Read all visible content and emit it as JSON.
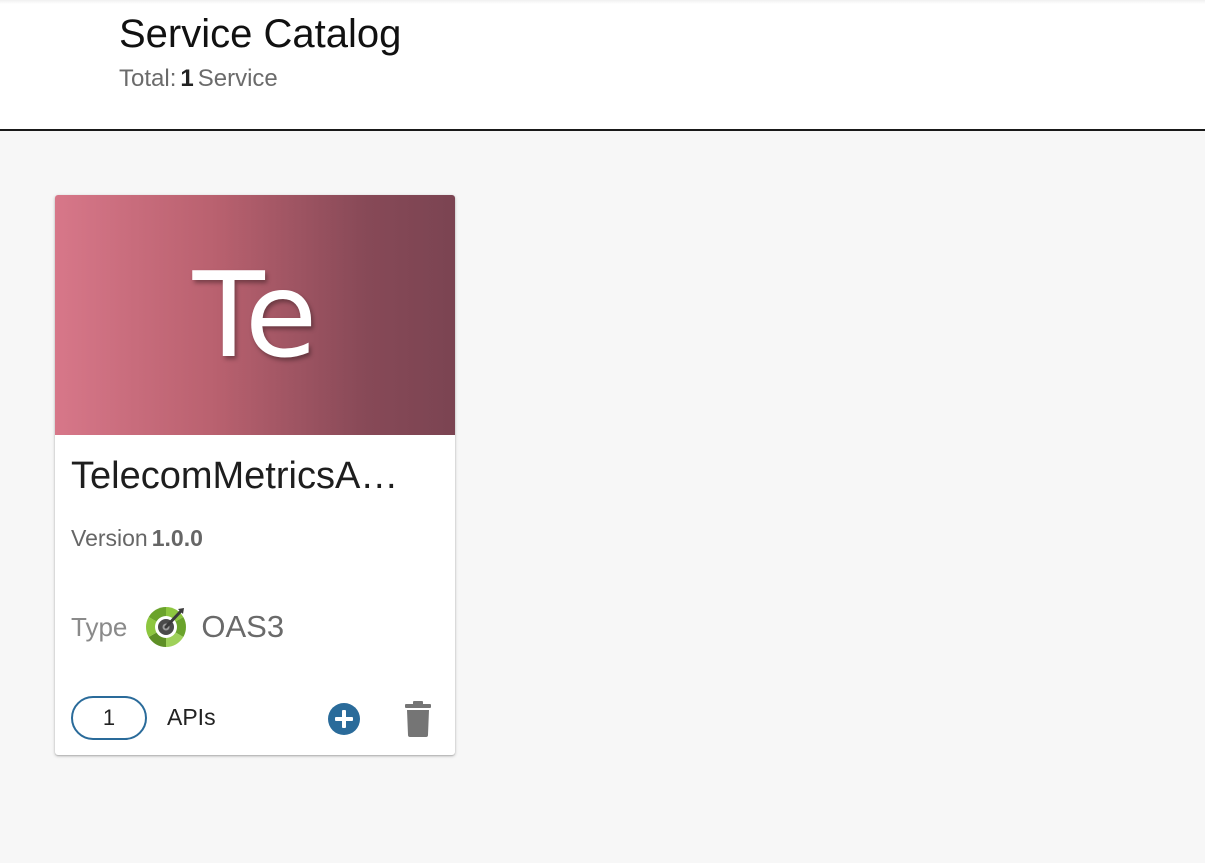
{
  "header": {
    "title": "Service Catalog",
    "total_prefix": "Total:",
    "total_count": "1",
    "total_suffix": "Service"
  },
  "services": [
    {
      "initials": "Te",
      "name": "TelecomMetricsA…",
      "version_label": "Version",
      "version": "1.0.0",
      "type_label": "Type",
      "type_icon": "oas3-swagger-icon",
      "type": "OAS3",
      "api_count": "1",
      "api_label": "APIs",
      "banner_colors": [
        "#d77789",
        "#7b4452"
      ],
      "actions": [
        "add-api",
        "delete-service"
      ]
    }
  ],
  "colors": {
    "accent": "#2a6b9a",
    "delete": "#757575",
    "header_border": "#1a1a1a",
    "background": "#f7f7f7"
  }
}
